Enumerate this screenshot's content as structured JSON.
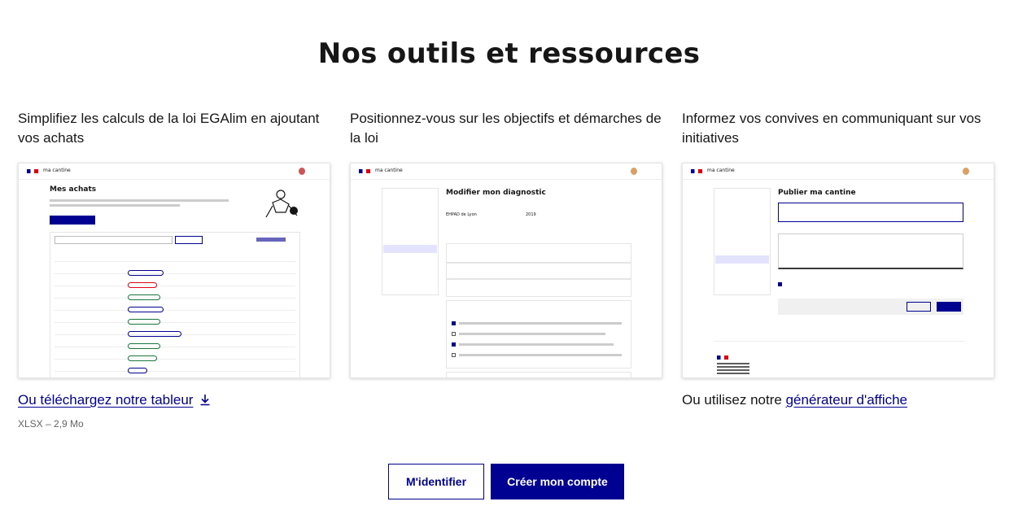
{
  "section": {
    "title": "Nos outils et ressources"
  },
  "cards": [
    {
      "description": "Simplifiez les calculs de la loi EGAlim en ajoutant vos achats",
      "link_text": "Ou téléchargez notre tableur",
      "file_meta": "XLSX – 2,9 Mo",
      "preview": {
        "brand": "ma cantine",
        "heading": "Mes achats"
      }
    },
    {
      "description": "Positionnez-vous sur les objectifs et démarches de la loi",
      "preview": {
        "brand": "ma cantine",
        "heading": "Modifier mon diagnostic",
        "field_value_1": "EHPAD de Lyon",
        "field_value_2": "2019"
      }
    },
    {
      "description": "Informez vos convives en communiquant sur vos initiatives",
      "link_prefix": "Ou utilisez notre",
      "link_text": "générateur d'affiche",
      "preview": {
        "brand": "ma cantine",
        "heading": "Publier ma cantine"
      }
    }
  ],
  "buttons": {
    "login": "M'identifier",
    "signup": "Créer mon compte"
  },
  "colors": {
    "primary": "#000091",
    "text": "#161616",
    "muted": "#666666"
  }
}
